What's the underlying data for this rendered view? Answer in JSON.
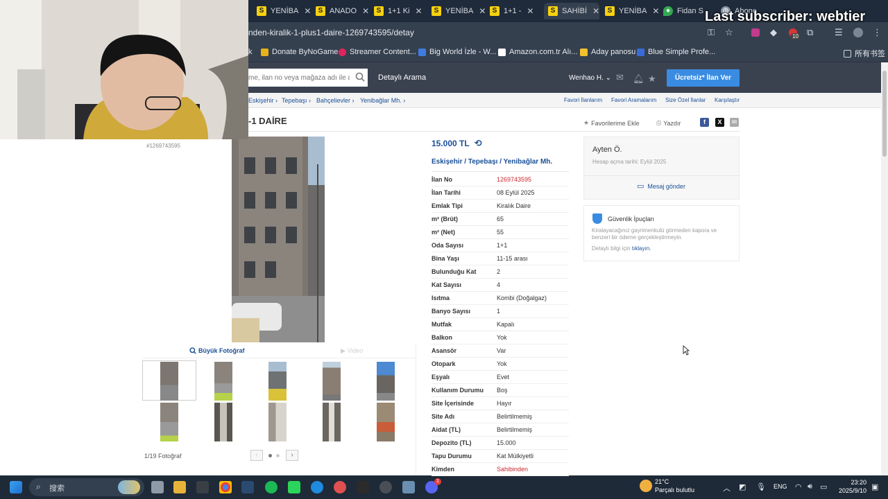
{
  "browser": {
    "tabs": [
      {
        "label": "YENİBA",
        "fav": "S"
      },
      {
        "label": "ANADO",
        "fav": "S"
      },
      {
        "label": "1+1 Ki",
        "fav": "S"
      },
      {
        "label": "YENİBA",
        "fav": "S"
      },
      {
        "label": "1+1 - ",
        "fav": "S"
      },
      {
        "label": "SAHİBİ",
        "fav": "S"
      },
      {
        "label": "YENİBA",
        "fav": "S"
      },
      {
        "label": "Fidan S",
        "fav": "map-pin-icon"
      },
      {
        "label": "Abone",
        "fav": "globe-icon"
      }
    ],
    "url": "nden-kiralik-1-plus1-daire-1269743595/detay",
    "bookmarks": [
      "k",
      "Donate ByNoGame",
      "Streamer Content...",
      "Big World İzle - W...",
      "Amazon.com.tr Alı...",
      "Aday panosu",
      "Blue Simple Profe..."
    ],
    "bookmarks_folder": "所有书签",
    "ext_badge": "10"
  },
  "overlay": {
    "text": "Last subscriber: webtier"
  },
  "header": {
    "search_placeholder": "me, ilan no veya mağaza adı ile ara",
    "advanced_search": "Detaylı Arama",
    "user": "Wenhao H.",
    "post_button": "Ücretsiz* İlan Ver"
  },
  "breadcrumb": {
    "items": [
      "Eskişehir",
      "Tepebaşı",
      "Bahçelievler",
      "Yenibağlar Mh."
    ],
    "right": [
      "Favori İlanlarım",
      "Favori Aramalarım",
      "Size Özel İlanlar",
      "Karşılaştır"
    ]
  },
  "listing": {
    "title": "-1 DAİRE",
    "small_id": "#1269743595",
    "actions": {
      "favorite": "Favorilerime Ekle",
      "print": "Yazdır"
    },
    "price": "15.000 TL",
    "location": [
      "Eskişehir",
      "Tepebaşı",
      "Yenibağlar Mh."
    ],
    "details": [
      {
        "k": "İlan No",
        "v": "1269743595",
        "red": true
      },
      {
        "k": "İlan Tarihi",
        "v": "08 Eylül 2025"
      },
      {
        "k": "Emlak Tipi",
        "v": "Kiralık Daire"
      },
      {
        "k": "m² (Brüt)",
        "v": "65"
      },
      {
        "k": "m² (Net)",
        "v": "55"
      },
      {
        "k": "Oda Sayısı",
        "v": "1+1"
      },
      {
        "k": "Bina Yaşı",
        "v": "11-15 arası"
      },
      {
        "k": "Bulunduğu Kat",
        "v": "2"
      },
      {
        "k": "Kat Sayısı",
        "v": "4"
      },
      {
        "k": "Isıtma",
        "v": "Kombi (Doğalgaz)"
      },
      {
        "k": "Banyo Sayısı",
        "v": "1"
      },
      {
        "k": "Mutfak",
        "v": "Kapalı"
      },
      {
        "k": "Balkon",
        "v": "Yok"
      },
      {
        "k": "Asansör",
        "v": "Var"
      },
      {
        "k": "Otopark",
        "v": "Yok"
      },
      {
        "k": "Eşyalı",
        "v": "Evet"
      },
      {
        "k": "Kullanım Durumu",
        "v": "Boş"
      },
      {
        "k": "Site İçerisinde",
        "v": "Hayır"
      },
      {
        "k": "Site Adı",
        "v": "Belirtilmemiş"
      },
      {
        "k": "Aidat (TL)",
        "v": "Belirtilmemiş"
      },
      {
        "k": "Depozito (TL)",
        "v": "15.000"
      },
      {
        "k": "Tapu Durumu",
        "v": "Kat Mülkiyetli"
      },
      {
        "k": "Kimden",
        "v": "Sahibinden",
        "red": true
      }
    ]
  },
  "photos": {
    "big_photo_label": "Büyük Fotoğraf",
    "video_label": "Video",
    "count": "1/19 Fotoğraf"
  },
  "seller": {
    "name": "Ayten Ö.",
    "since": "Hesap açma tarihi: Eylül 2025",
    "message": "Mesaj gönder"
  },
  "safety": {
    "title": "Güvenlik İpuçları",
    "text": "Kiralayacağınız gayrimenkulü görmeden kapora ve benzeri bir ödeme gerçekleştirmeyin.",
    "more_prefix": "Detaylı bilgi için",
    "more_link": "tıklayın."
  },
  "taskbar": {
    "search": "搜索",
    "weather_temp": "21°C",
    "weather_desc": "Parçalı bulutlu",
    "lang": "ENG",
    "time": "23:20",
    "date": "2025/9/10",
    "discord_badge": "1"
  },
  "colors": {
    "link": "#1a4f96",
    "accent_button": "#3a8ce2",
    "red": "#c8282e",
    "header": "#3a4250"
  }
}
